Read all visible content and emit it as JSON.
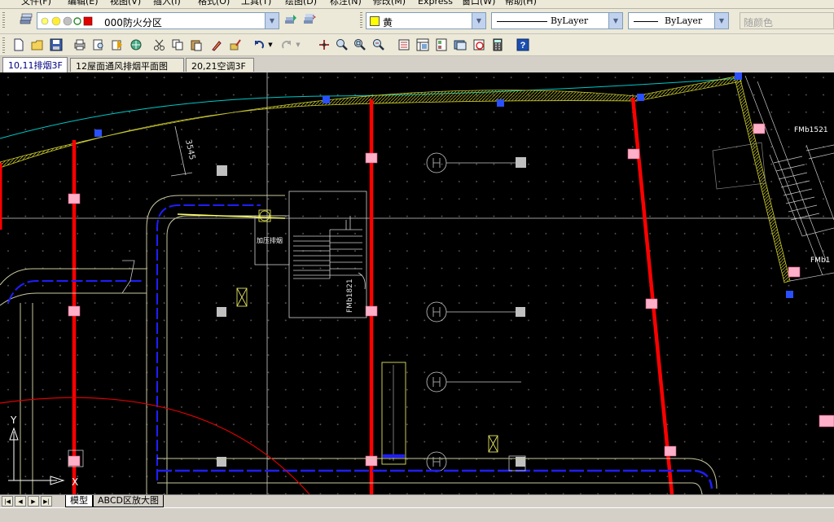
{
  "menu": {
    "items": [
      "文件(F)",
      "编辑(E)",
      "视图(V)",
      "插入(I)",
      "格式(O)",
      "工具(T)",
      "绘图(D)",
      "标注(N)",
      "修改(M)",
      "Express",
      "窗口(W)",
      "帮助(H)"
    ]
  },
  "toolbar": {
    "layer_name": "000防火分区",
    "color_name": "黄",
    "linetype": "ByLayer",
    "lineweight": "ByLayer",
    "plotstyle": "随颜色"
  },
  "tabs": {
    "items": [
      "10,11排烟3F",
      "12屋面通风排烟平面图",
      "20,21空调3F"
    ]
  },
  "drawing": {
    "dimension": "3545",
    "door_label_1": "FMb1521",
    "door_label_2": "FMb1821",
    "door_label_3": "FMb1",
    "room_label": "加压排烟",
    "ucs_y": "Y",
    "ucs_x": "X"
  },
  "layouts": {
    "items": [
      "模型",
      "ABCD区放大图"
    ]
  },
  "colors": {
    "canvas_bg": "#000000",
    "wall_red": "#ff0000",
    "duct_blue": "#0000ff",
    "dot_grid": "#5a5a5a",
    "layer_yellow": "#ffff00"
  }
}
